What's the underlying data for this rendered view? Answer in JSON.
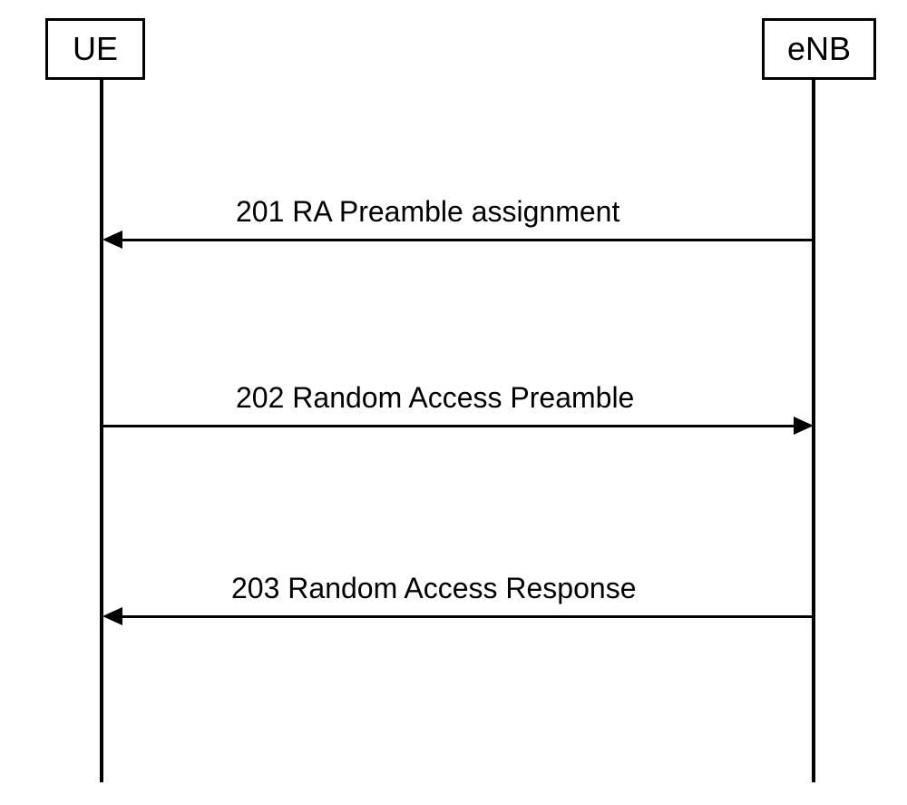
{
  "actors": {
    "left": "UE",
    "right": "eNB"
  },
  "messages": {
    "m1": "201 RA Preamble assignment",
    "m2": "202 Random Access Preamble",
    "m3": "203  Random Access Response"
  }
}
